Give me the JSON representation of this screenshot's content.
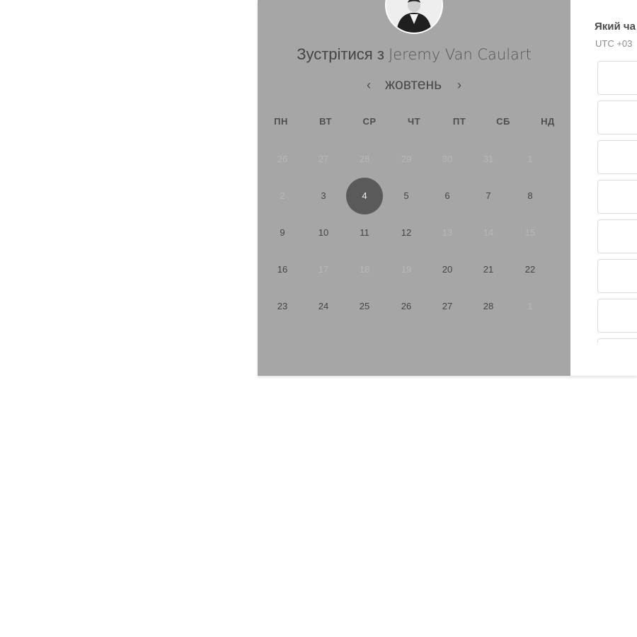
{
  "meeting": {
    "prefix": "Зустрітися з",
    "person": "Jeremy Van Caulart"
  },
  "calendar": {
    "month": "жовтень",
    "prev_icon": "chevron-left-icon",
    "next_icon": "chevron-right-icon",
    "weekdays": [
      "ПН",
      "ВТ",
      "СР",
      "ЧТ",
      "ПТ",
      "СБ",
      "НД"
    ],
    "weeks": [
      [
        {
          "d": "26",
          "muted": true
        },
        {
          "d": "27",
          "muted": true
        },
        {
          "d": "28",
          "muted": true
        },
        {
          "d": "29",
          "muted": true
        },
        {
          "d": "30",
          "muted": true
        },
        {
          "d": "31",
          "muted": true
        },
        {
          "d": "1",
          "muted": true
        }
      ],
      [
        {
          "d": "2",
          "muted": true
        },
        {
          "d": "3"
        },
        {
          "d": "4",
          "selected": true
        },
        {
          "d": "5"
        },
        {
          "d": "6"
        },
        {
          "d": "7"
        },
        {
          "d": "8"
        }
      ],
      [
        {
          "d": "9"
        },
        {
          "d": "10"
        },
        {
          "d": "11"
        },
        {
          "d": "12"
        },
        {
          "d": "13",
          "muted": true
        },
        {
          "d": "14",
          "muted": true
        },
        {
          "d": "15",
          "muted": true
        }
      ],
      [
        {
          "d": "16"
        },
        {
          "d": "17",
          "muted": true
        },
        {
          "d": "18",
          "muted": true
        },
        {
          "d": "19",
          "muted": true
        },
        {
          "d": "20"
        },
        {
          "d": "21"
        },
        {
          "d": "22"
        }
      ],
      [
        {
          "d": "23"
        },
        {
          "d": "24"
        },
        {
          "d": "25"
        },
        {
          "d": "26"
        },
        {
          "d": "27"
        },
        {
          "d": "28"
        },
        {
          "d": "1",
          "muted": true
        }
      ]
    ]
  },
  "time_picker": {
    "title": "Який ча",
    "timezone": "UTC +03",
    "slot_count": 8
  },
  "colors": {
    "panel_bg": "#a6a6a6",
    "selected_day": "#5a5a5a"
  }
}
